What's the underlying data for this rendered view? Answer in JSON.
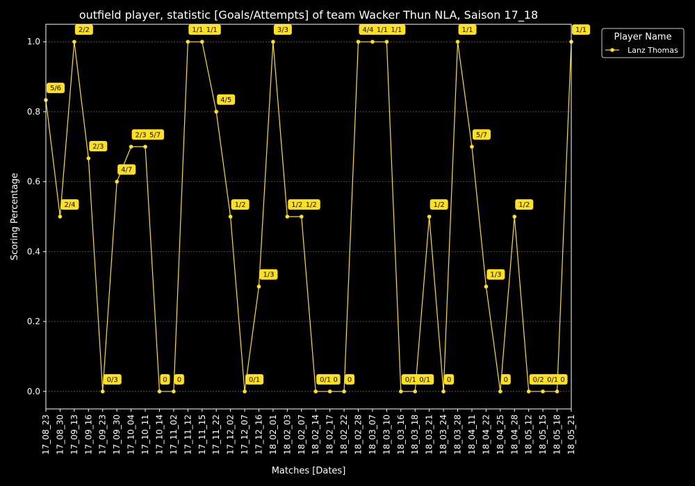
{
  "chart_data": {
    "type": "line",
    "title": "outfield player, statistic [Goals/Attempts] of team Wacker Thun NLA, Saison 17_18",
    "xlabel": "Matches [Dates]",
    "ylabel": "Scoring Percentage",
    "ylim": [
      -0.05,
      1.05
    ],
    "yticks": [
      0.0,
      0.2,
      0.4,
      0.6,
      0.8,
      1.0
    ],
    "ytick_labels": [
      "0.0",
      "0.2",
      "0.4",
      "0.6",
      "0.8",
      "1.0"
    ],
    "grid": true,
    "legend": {
      "title": "Player Name",
      "placement": "top-right outside"
    },
    "categories": [
      "17_08_23",
      "17_08_30",
      "17_09_13",
      "17_09_16",
      "17_09_23",
      "17_09_30",
      "17_10_04",
      "17_10_11",
      "17_10_14",
      "17_11_02",
      "17_11_12",
      "17_11_15",
      "17_11_22",
      "17_12_02",
      "17_12_07",
      "17_12_16",
      "18_02_01",
      "18_02_03",
      "18_02_07",
      "18_02_14",
      "18_02_17",
      "18_02_22",
      "18_02_28",
      "18_03_07",
      "18_03_10",
      "18_03_16",
      "18_03_18",
      "18_03_21",
      "18_03_24",
      "18_03_28",
      "18_04_11",
      "18_04_22",
      "18_04_25",
      "18_04_28",
      "18_05_12",
      "18_05_15",
      "18_05_18",
      "18_05_21"
    ],
    "series": [
      {
        "name": "Lanz Thomas",
        "color": "#ffe119",
        "values": [
          0.8333,
          0.5,
          1.0,
          0.6667,
          0.0,
          0.6,
          0.7,
          0.7,
          0.0,
          0.0,
          1.0,
          1.0,
          0.8,
          0.5,
          0.0,
          0.3,
          1.0,
          0.5,
          0.5,
          0.0,
          0.0,
          0.0,
          1.0,
          1.0,
          1.0,
          0.0,
          0.0,
          0.5,
          0.0,
          1.0,
          0.7,
          0.3,
          0.0,
          0.5,
          0.0,
          0.0,
          0.0,
          1.0
        ],
        "point_labels": [
          "5/6",
          "2/4",
          "2/2",
          "2/3",
          "0/3",
          "4/7",
          "2/3",
          "5/7",
          "0",
          "0",
          "1/1",
          "1/1",
          "4/5",
          "1/2",
          "0/1",
          "1/3",
          "3/3",
          "1/2",
          "1/2",
          "0/1",
          "0",
          "0",
          "4/4",
          "1/1",
          "1/1",
          "0/1",
          "0/1",
          "1/2",
          "0",
          "1/1",
          "5/7",
          "1/3",
          "0",
          "1/2",
          "0/2",
          "0/1",
          "0",
          "1/1"
        ]
      }
    ]
  }
}
